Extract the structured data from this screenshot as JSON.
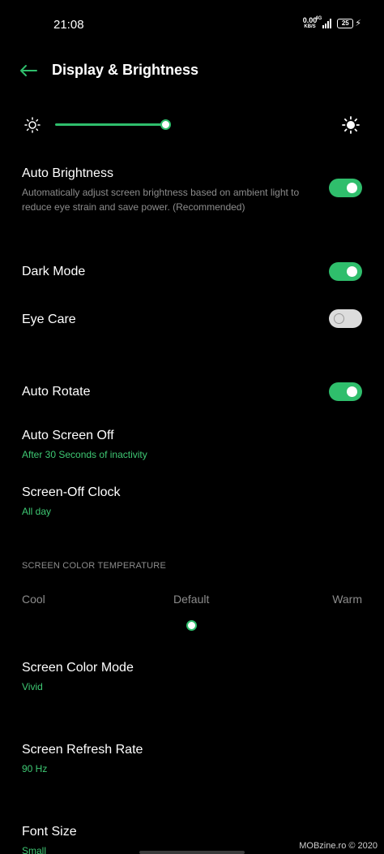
{
  "status_bar": {
    "time": "21:08",
    "net_speed_value": "0.00",
    "net_speed_unit": "KB/S",
    "network_type": "4G",
    "battery_level": "25",
    "icons": [
      "signal-icon",
      "battery-icon",
      "charging-icon"
    ]
  },
  "header": {
    "back_icon": "arrow-left-icon",
    "title": "Display & Brightness"
  },
  "brightness": {
    "level_percent": 39,
    "min_icon": "sun-small-icon",
    "max_icon": "sun-large-icon"
  },
  "settings": {
    "auto_brightness": {
      "title": "Auto Brightness",
      "description": "Automatically adjust screen brightness based on ambient light to reduce eye strain and save power. (Recommended)",
      "enabled": true
    },
    "dark_mode": {
      "title": "Dark Mode",
      "enabled": true
    },
    "eye_care": {
      "title": "Eye Care",
      "enabled": false
    },
    "auto_rotate": {
      "title": "Auto Rotate",
      "enabled": true
    },
    "auto_screen_off": {
      "title": "Auto Screen Off",
      "value": "After 30 Seconds of inactivity"
    },
    "screen_off_clock": {
      "title": "Screen-Off Clock",
      "value": "All day"
    },
    "color_temperature": {
      "header": "SCREEN COLOR TEMPERATURE",
      "cool_label": "Cool",
      "default_label": "Default",
      "warm_label": "Warm",
      "position": "Default"
    },
    "screen_color_mode": {
      "title": "Screen Color Mode",
      "value": "Vivid"
    },
    "screen_refresh_rate": {
      "title": "Screen Refresh Rate",
      "value": "90 Hz"
    },
    "font_size": {
      "title": "Font Size",
      "value": "Small"
    }
  },
  "watermark": "MOBzine.ro © 2020",
  "colors": {
    "accent": "#2fbe6c",
    "accent_text": "#3ec873",
    "background": "#000000",
    "secondary_text": "#8c8c8c"
  }
}
